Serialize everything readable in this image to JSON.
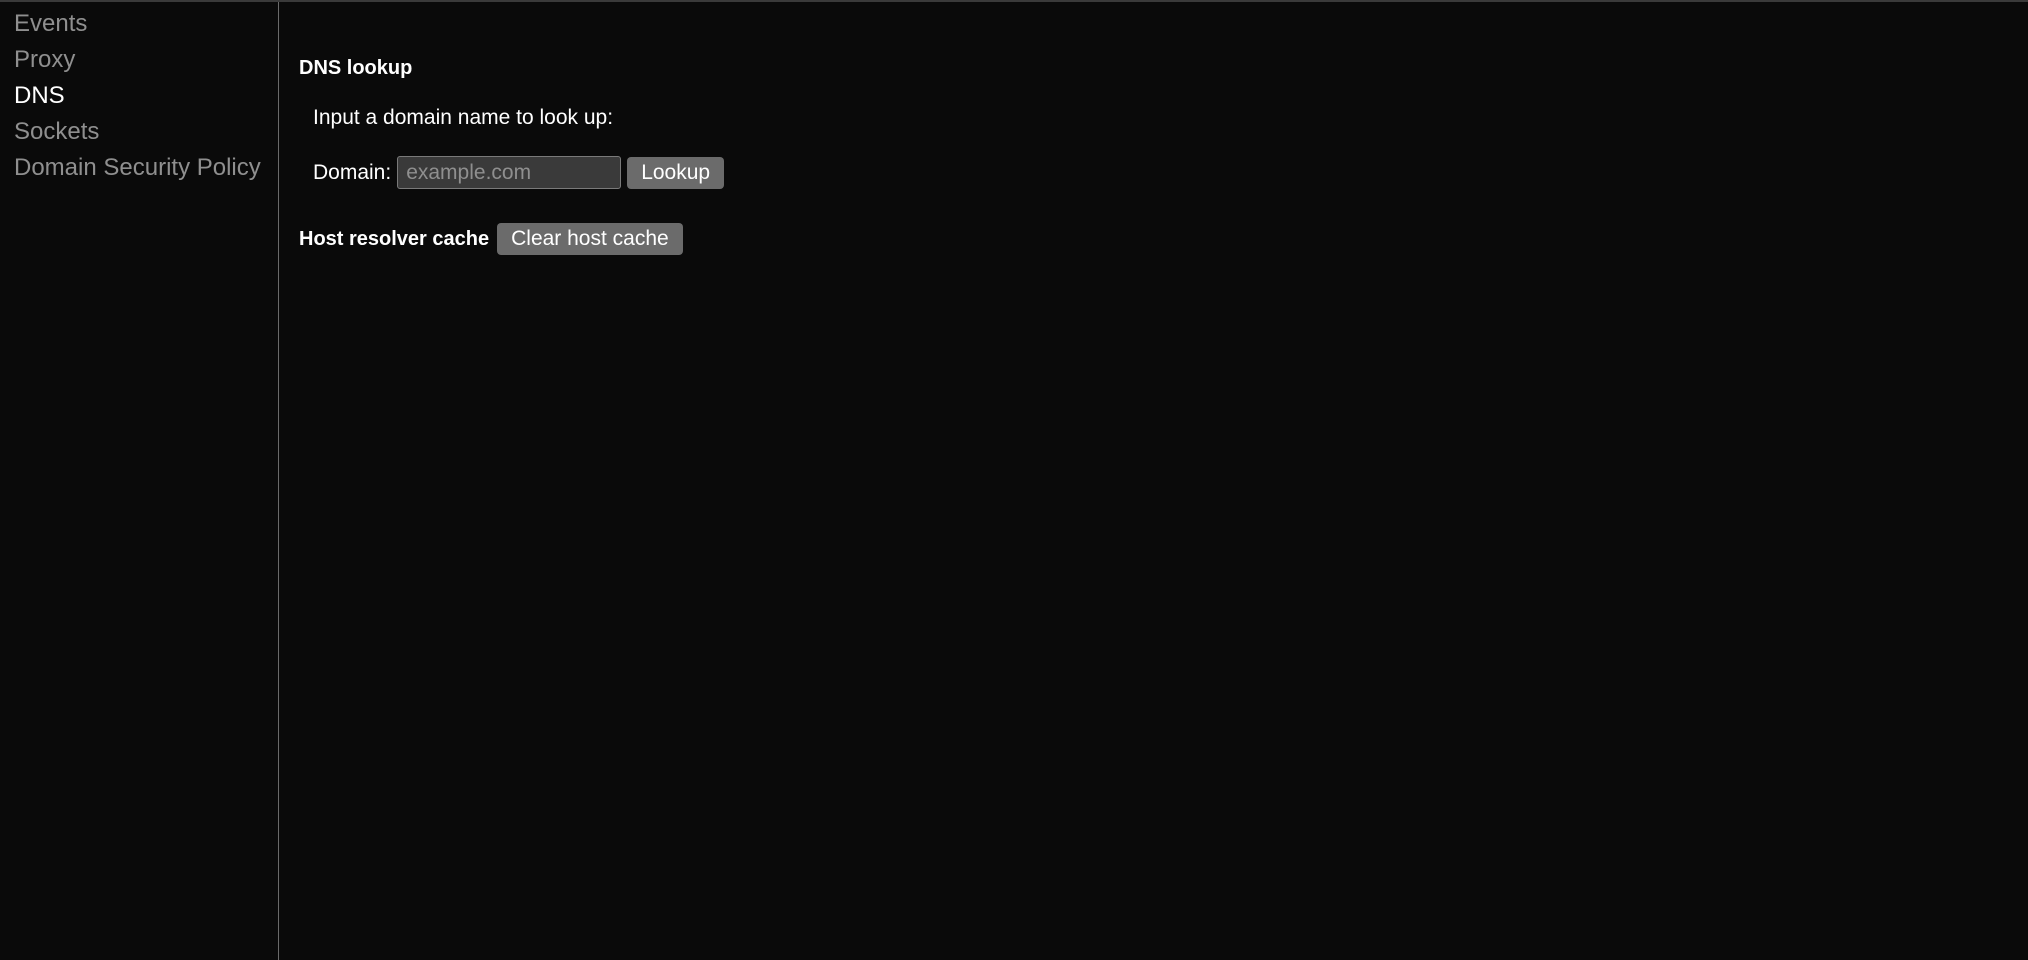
{
  "sidebar": {
    "items": [
      {
        "label": "Events",
        "active": false
      },
      {
        "label": "Proxy",
        "active": false
      },
      {
        "label": "DNS",
        "active": true
      },
      {
        "label": "Sockets",
        "active": false
      },
      {
        "label": "Domain Security Policy",
        "active": false
      }
    ]
  },
  "main": {
    "dns_lookup": {
      "title": "DNS lookup",
      "instruction": "Input a domain name to look up:",
      "domain_label": "Domain:",
      "domain_placeholder": "example.com",
      "domain_value": "",
      "lookup_button": "Lookup"
    },
    "host_cache": {
      "label": "Host resolver cache",
      "clear_button": "Clear host cache"
    }
  }
}
